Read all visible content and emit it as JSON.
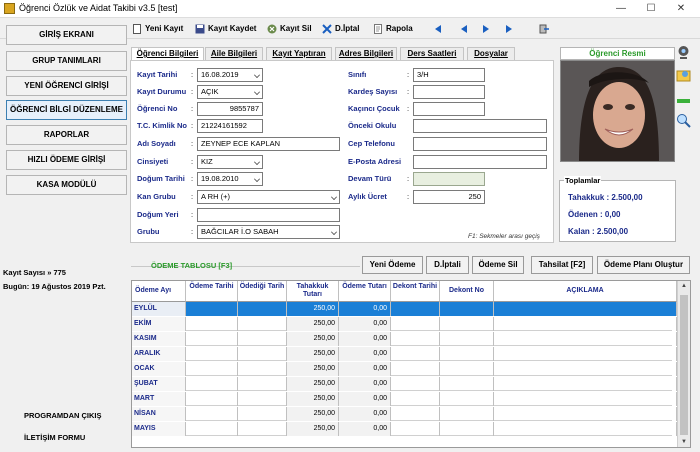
{
  "window": {
    "title": "Öğrenci Özlük ve Aidat Takibi v3.5  [test]",
    "minimize": "—",
    "maximize": "☐",
    "close": "✕"
  },
  "toolbar": {
    "new": "Yeni Kayıt",
    "save": "Kayıt Kaydet",
    "delete": "Kayıt Sil",
    "cancel": "D.İptal",
    "report": "Rapola"
  },
  "sidebar": {
    "items": [
      "GİRİŞ EKRANI",
      "GRUP TANIMLARI",
      "YENİ ÖĞRENCİ GİRİŞİ",
      "ÖĞRENCİ BİLGİ DÜZENLEME",
      "RAPORLAR",
      "HIZLI ÖDEME GİRİŞİ",
      "KASA MODÜLÜ"
    ],
    "record_count": "Kayıt Sayısı » 775",
    "today": "Bugün: 19 Ağustos 2019 Pzt.",
    "exit": "PROGRAMDAN ÇIKIŞ",
    "contact": "İLETİŞİM FORMU"
  },
  "tabs": [
    "Öğrenci Bilgileri",
    "Aile Bilgileri",
    "Kayıt Yaptıran",
    "Adres Bilgileri",
    "Ders Saatleri",
    "Dosyalar"
  ],
  "form": {
    "kayit_tarihi": {
      "label": "Kayıt Tarihi",
      "value": "16.08.2019"
    },
    "kayit_durumu": {
      "label": "Kayıt Durumu",
      "value": "AÇIK"
    },
    "ogrenci_no": {
      "label": "Öğrenci No",
      "value": "9855787"
    },
    "tc": {
      "label": "T.C. Kimlik No",
      "value": "21224161592"
    },
    "adi_soyadi": {
      "label": "Adı Soyadı",
      "value": "ZEYNEP ECE KAPLAN"
    },
    "cinsiyeti": {
      "label": "Cinsiyeti",
      "value": "KIZ"
    },
    "dogum_tarihi": {
      "label": "Doğum Tarihi",
      "value": "19.08.2010"
    },
    "kan_grubu": {
      "label": "Kan Grubu",
      "value": "A RH (+)"
    },
    "dogum_yeri": {
      "label": "Doğum Yeri",
      "value": ""
    },
    "grubu": {
      "label": "Grubu",
      "value": "BAĞCILAR İ.O SABAH"
    },
    "sinifi": {
      "label": "Sınıfı",
      "value": "3/H"
    },
    "kardes": {
      "label": "Kardeş Sayısı",
      "value": ""
    },
    "kacinci": {
      "label": "Kaçıncı Çocuk",
      "value": ""
    },
    "onceki_okul": {
      "label": "Önceki Okulu",
      "value": ""
    },
    "cep": {
      "label": "Cep Telefonu",
      "value": ""
    },
    "eposta": {
      "label": "E-Posta Adresi",
      "value": ""
    },
    "devam": {
      "label": "Devam Türü",
      "value": ""
    },
    "ucret": {
      "label": "Aylık Ücret",
      "value": "250"
    },
    "hint": "F1: Sekmeler arası geçiş"
  },
  "photo": {
    "title": "Öğrenci Resmi"
  },
  "totals": {
    "caption": "Toplamlar",
    "tahakkuk": "Tahakkuk : 2.500,00",
    "odenen": "Ödenen    : 0,00",
    "kalan": "Kalan       : 2.500,00"
  },
  "payments": {
    "title": "ÖDEME TABLOSU [F3]",
    "buttons": [
      "Yeni Ödeme",
      "D.İptali",
      "Ödeme Sil",
      "Tahsilat [F2]",
      "Ödeme Planı Oluştur"
    ],
    "headers": [
      "Ödeme Ayı",
      "Ödeme Tarihi",
      "Ödediği Tarih",
      "Tahakkuk Tutarı",
      "Ödeme Tutarı",
      "Dekont Tarihi",
      "Dekont No",
      "AÇIKLAMA"
    ],
    "rows": [
      [
        "EYLÜL",
        "",
        "",
        "250,00",
        "0,00",
        "",
        "",
        ""
      ],
      [
        "EKİM",
        "",
        "",
        "250,00",
        "0,00",
        "",
        "",
        ""
      ],
      [
        "KASIM",
        "",
        "",
        "250,00",
        "0,00",
        "",
        "",
        ""
      ],
      [
        "ARALIK",
        "",
        "",
        "250,00",
        "0,00",
        "",
        "",
        ""
      ],
      [
        "OCAK",
        "",
        "",
        "250,00",
        "0,00",
        "",
        "",
        ""
      ],
      [
        "ŞUBAT",
        "",
        "",
        "250,00",
        "0,00",
        "",
        "",
        ""
      ],
      [
        "MART",
        "",
        "",
        "250,00",
        "0,00",
        "",
        "",
        ""
      ],
      [
        "NİSAN",
        "",
        "",
        "250,00",
        "0,00",
        "",
        "",
        ""
      ],
      [
        "MAYIS",
        "",
        "",
        "250,00",
        "0,00",
        "",
        "",
        ""
      ]
    ]
  }
}
